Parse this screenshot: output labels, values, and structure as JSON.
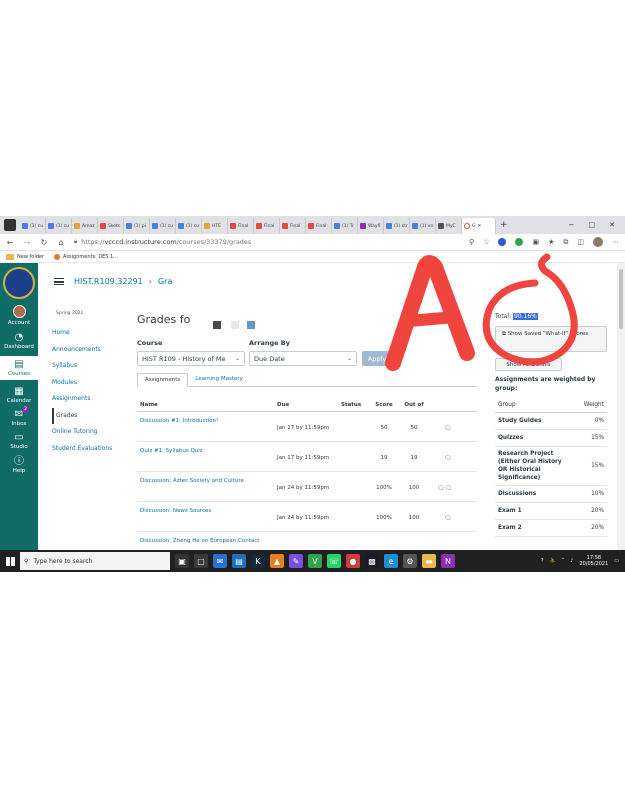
{
  "browser": {
    "tabs": [
      {
        "label": "(1) cu",
        "color": "#4d7de0"
      },
      {
        "label": "(1) cu",
        "color": "#4d7de0"
      },
      {
        "label": "Amaz",
        "color": "#e8a23a"
      },
      {
        "label": "Sketc",
        "color": "#e54a3c"
      },
      {
        "label": "(1) pi",
        "color": "#4d7de0"
      },
      {
        "label": "(1) cu",
        "color": "#4d7de0"
      },
      {
        "label": "(1) cu",
        "color": "#4d7de0"
      },
      {
        "label": "HTE",
        "color": "#e8a23a"
      },
      {
        "label": "Final",
        "color": "#e54a3c"
      },
      {
        "label": "Final",
        "color": "#e54a3c"
      },
      {
        "label": "Final",
        "color": "#e54a3c"
      },
      {
        "label": "Final",
        "color": "#e54a3c"
      },
      {
        "label": "(1) Tr",
        "color": "#4d7de0"
      },
      {
        "label": "Wayfi",
        "color": "#8c2fb5"
      },
      {
        "label": "(1) str",
        "color": "#4d7de0"
      },
      {
        "label": "(1) vo",
        "color": "#4d7de0"
      },
      {
        "label": "MyC",
        "color": "#555555"
      }
    ],
    "active_tab_label": "G",
    "new_tab": "+",
    "window_controls": {
      "minimize": "−",
      "maximize": "□",
      "close": "✕"
    },
    "url_prefix": "https://",
    "url_host": "vcccd.instructure.com",
    "url_path": "/courses/33379/grades",
    "bookmarks": [
      {
        "label": "New folder",
        "kind": "folder"
      },
      {
        "label": "Assignments: DES 1...",
        "kind": "site"
      }
    ]
  },
  "global_nav": {
    "items": [
      {
        "label": "Account",
        "icon": "user-avatar"
      },
      {
        "label": "Dashboard",
        "icon": "dashboard-icon"
      },
      {
        "label": "Courses",
        "icon": "courses-icon"
      },
      {
        "label": "Calendar",
        "icon": "calendar-icon"
      },
      {
        "label": "Inbox",
        "icon": "inbox-icon",
        "badge": "2"
      },
      {
        "label": "Studio",
        "icon": "studio-icon"
      },
      {
        "label": "Help",
        "icon": "help-icon"
      }
    ]
  },
  "breadcrumb": {
    "course": "HIST.R109.32291",
    "separator": "›",
    "current": "Gra"
  },
  "course_nav": {
    "term": "Spring 2021",
    "items": [
      "Home",
      "Announcements",
      "Syllabus",
      "Modules",
      "Assignments",
      "Grades",
      "Online Tutoring",
      "Student Evaluations"
    ],
    "active": "Grades"
  },
  "grades": {
    "title": "Grades fo",
    "print_label": "Print Grades",
    "course_label": "Course",
    "arrange_label": "Arrange By",
    "course_value": "HIST R109 - History of Me",
    "arrange_value": "Due Date",
    "apply_label": "Apply",
    "tabs": [
      "Assignments",
      "Learning Mastery"
    ],
    "columns": {
      "name": "Name",
      "due": "Due",
      "status": "Status",
      "score": "Score",
      "out_of": "Out of"
    },
    "rows": [
      {
        "name": "Discussion #1: Introduction!",
        "due": "Jan 17 by 11:59pm",
        "score": "50",
        "out_of": "50",
        "icons": "comment-icon"
      },
      {
        "name": "Quiz #1: Syllabus Quiz",
        "due": "Jan 17 by 11:59pm",
        "score": "19",
        "out_of": "19",
        "icons": "comment-icon"
      },
      {
        "name": "Discussion: Aztec Society and Culture",
        "due": "Jan 24 by 11:59pm",
        "score": "100%",
        "out_of": "100",
        "icons": "comment-icon"
      },
      {
        "name": "Discussion: News Sources",
        "due": "Jan 24 by 11:59pm",
        "score": "100%",
        "out_of": "100",
        "icons": "comment-icon"
      },
      {
        "name": "Discussion: Zheng He on European Contact",
        "due": "",
        "score": "",
        "out_of": "",
        "icons": ""
      }
    ]
  },
  "sidebar": {
    "total_label": "Total:",
    "total_value": "90.16%",
    "whatif_label": "Show Saved \"What-If\" Scores",
    "details_label": "Show All Details",
    "weighted_note": "Assignments are weighted by group:",
    "weights_header": {
      "group": "Group",
      "weight": "Weight"
    },
    "weights": [
      {
        "group": "Study Guides",
        "weight": "0%"
      },
      {
        "group": "Quizzes",
        "weight": "15%"
      },
      {
        "group": "Research Project (Either Oral History OR Historical Significance)",
        "weight": "15%"
      },
      {
        "group": "Discussions",
        "weight": "10%"
      },
      {
        "group": "Exam 1",
        "weight": "20%"
      },
      {
        "group": "Exam 2",
        "weight": "20%"
      }
    ]
  },
  "taskbar": {
    "search_placeholder": "Type here to search",
    "time": "17:58",
    "date": "20/05/2021"
  },
  "annotation": {
    "text": "A",
    "color": "#f0453f"
  }
}
